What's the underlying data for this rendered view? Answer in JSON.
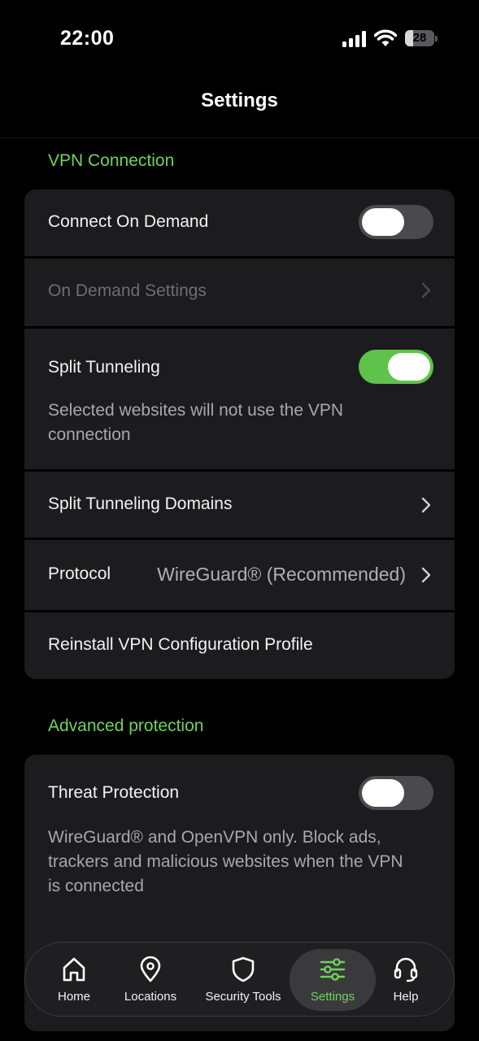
{
  "status_bar": {
    "time": "22:00",
    "battery": "28",
    "battery_level": 0.28
  },
  "header": {
    "title": "Settings"
  },
  "vpn_section": {
    "title": "VPN Connection",
    "connect_on_demand": {
      "label": "Connect On Demand",
      "enabled": false
    },
    "on_demand_settings": {
      "label": "On Demand Settings",
      "disabled": true
    },
    "split_tunneling": {
      "label": "Split Tunneling",
      "enabled": true,
      "description": "Selected websites will not use the VPN connection"
    },
    "split_tunneling_domains": {
      "label": "Split Tunneling Domains"
    },
    "protocol": {
      "label": "Protocol",
      "value": "WireGuard® (Recommended)"
    },
    "reinstall": {
      "label": "Reinstall VPN Configuration Profile"
    }
  },
  "advanced_section": {
    "title": "Advanced protection",
    "threat_protection": {
      "label": "Threat Protection",
      "enabled": false,
      "description": "WireGuard® and OpenVPN only. Block ads, trackers and malicious websites when the VPN is connected"
    }
  },
  "tab_bar": {
    "active": "Settings",
    "tabs": [
      {
        "label": "Home",
        "icon": "home-icon"
      },
      {
        "label": "Locations",
        "icon": "location-pin-icon"
      },
      {
        "label": "Security Tools",
        "icon": "shield-icon"
      },
      {
        "label": "Settings",
        "icon": "sliders-icon"
      },
      {
        "label": "Help",
        "icon": "headset-icon"
      }
    ]
  },
  "colors": {
    "accent": "#6fd35c",
    "toggle_on": "#5fc24a",
    "card": "#1c1c1e",
    "background": "#000000"
  }
}
